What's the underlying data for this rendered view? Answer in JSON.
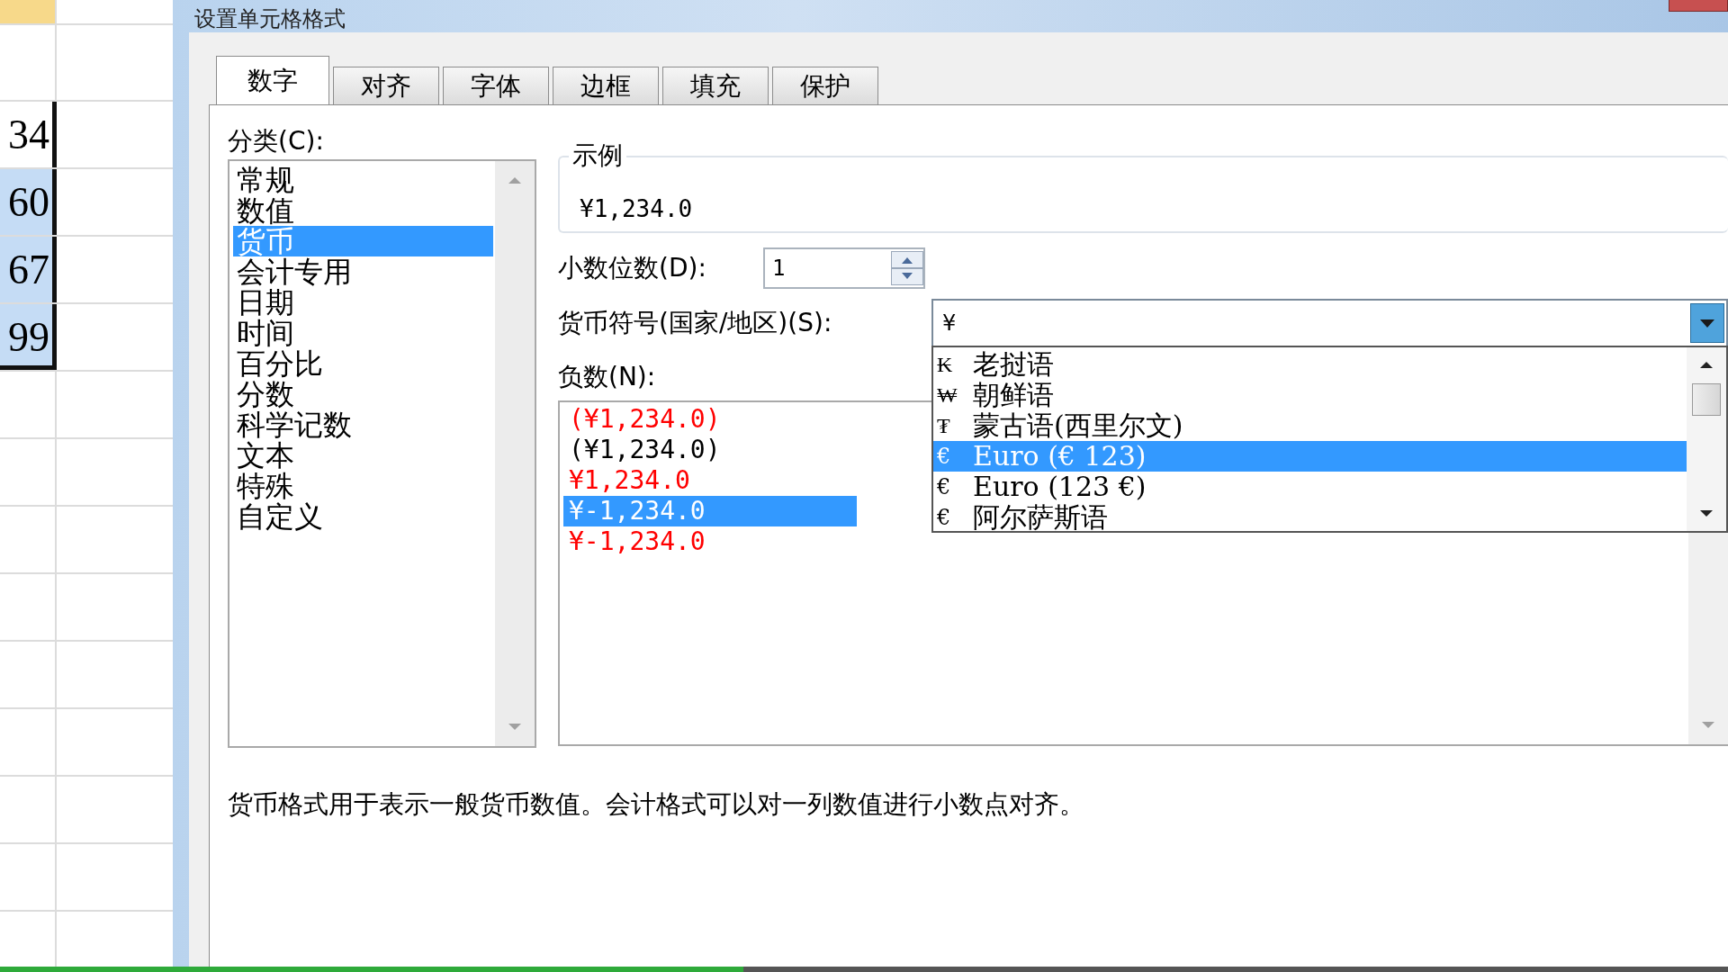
{
  "spreadsheet": {
    "cells": [
      {
        "text": "34",
        "selected": false
      },
      {
        "text": "60",
        "selected": true
      },
      {
        "text": "67",
        "selected": true
      },
      {
        "text": "99",
        "selected": true
      }
    ]
  },
  "dialog": {
    "title": "设置单元格格式",
    "tabs": [
      {
        "label": "数字",
        "selected": true
      },
      {
        "label": "对齐",
        "selected": false
      },
      {
        "label": "字体",
        "selected": false
      },
      {
        "label": "边框",
        "selected": false
      },
      {
        "label": "填充",
        "selected": false
      },
      {
        "label": "保护",
        "selected": false
      }
    ],
    "category": {
      "label": "分类(C):",
      "items": [
        {
          "label": "常规",
          "selected": false
        },
        {
          "label": "数值",
          "selected": false
        },
        {
          "label": "货币",
          "selected": true
        },
        {
          "label": "会计专用",
          "selected": false
        },
        {
          "label": "日期",
          "selected": false
        },
        {
          "label": "时间",
          "selected": false
        },
        {
          "label": "百分比",
          "selected": false
        },
        {
          "label": "分数",
          "selected": false
        },
        {
          "label": "科学记数",
          "selected": false
        },
        {
          "label": "文本",
          "selected": false
        },
        {
          "label": "特殊",
          "selected": false
        },
        {
          "label": "自定义",
          "selected": false
        }
      ]
    },
    "sample": {
      "label": "示例",
      "value": "¥1,234.0"
    },
    "decimal_places": {
      "label": "小数位数(D):",
      "value": "1"
    },
    "currency_symbol": {
      "label": "货币符号(国家/地区)(S):",
      "value": "¥",
      "options": [
        {
          "symbol": "₭",
          "label": "老挝语",
          "selected": false
        },
        {
          "symbol": "₩",
          "label": "朝鲜语",
          "selected": false
        },
        {
          "symbol": "₮",
          "label": "蒙古语(西里尔文)",
          "selected": false
        },
        {
          "symbol": "€",
          "label": "Euro (€ 123)",
          "selected": true
        },
        {
          "symbol": "€",
          "label": "Euro (123 €)",
          "selected": false
        },
        {
          "symbol": "€",
          "label": "阿尔萨斯语",
          "selected": false
        }
      ]
    },
    "negative_numbers": {
      "label": "负数(N):",
      "items": [
        {
          "text": "(¥1,234.0)",
          "color": "#ff0000",
          "selected": false
        },
        {
          "text": "(¥1,234.0)",
          "color": "#000000",
          "selected": false
        },
        {
          "text": "¥1,234.0",
          "color": "#ff0000",
          "selected": false
        },
        {
          "text": "¥-1,234.0",
          "selected": true
        },
        {
          "text": "¥-1,234.0",
          "color": "#ff0000",
          "selected": false
        }
      ]
    },
    "description": "货币格式用于表示一般货币数值。会计格式可以对一列数值进行小数点对齐。"
  },
  "video_progress": {
    "level": 0.43
  }
}
